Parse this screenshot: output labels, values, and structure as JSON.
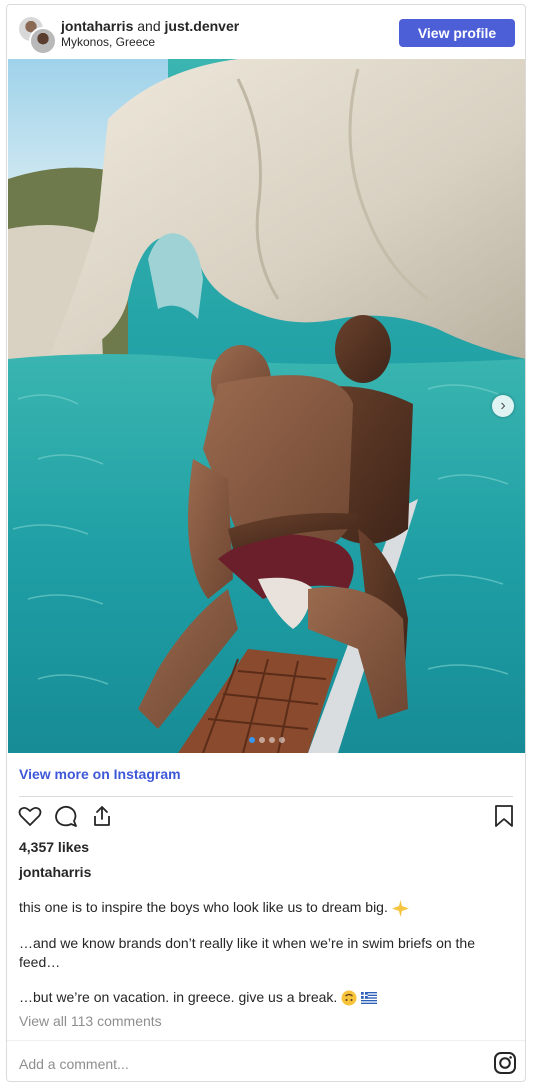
{
  "header": {
    "user1": "jontaharris",
    "joiner": "and",
    "user2": "just.denver",
    "location": "Mykonos, Greece",
    "view_profile_label": "View profile"
  },
  "post": {
    "view_more_label": "View more on Instagram",
    "likes": "4,357 likes",
    "username": "jontaharris",
    "caption_line1": "this one is to inspire the boys who look like us to dream big.",
    "caption_line2": "…and we know brands don’t really like it when we’re in swim briefs on the feed…",
    "caption_line3": "…but we’re on vacation. in greece. give us a break.",
    "comments_label": "View all 113 comments",
    "add_comment_placeholder": "Add a comment..."
  },
  "carousel": {
    "current": 1,
    "total": 4
  },
  "colors": {
    "accent": "#4c5fd7",
    "link": "#3f58d8",
    "muted": "#8e8e8e",
    "water": "#2aa6a8"
  },
  "icons": [
    "heart-icon",
    "comment-icon",
    "share-icon",
    "bookmark-icon",
    "instagram-icon",
    "chevron-right-icon"
  ]
}
